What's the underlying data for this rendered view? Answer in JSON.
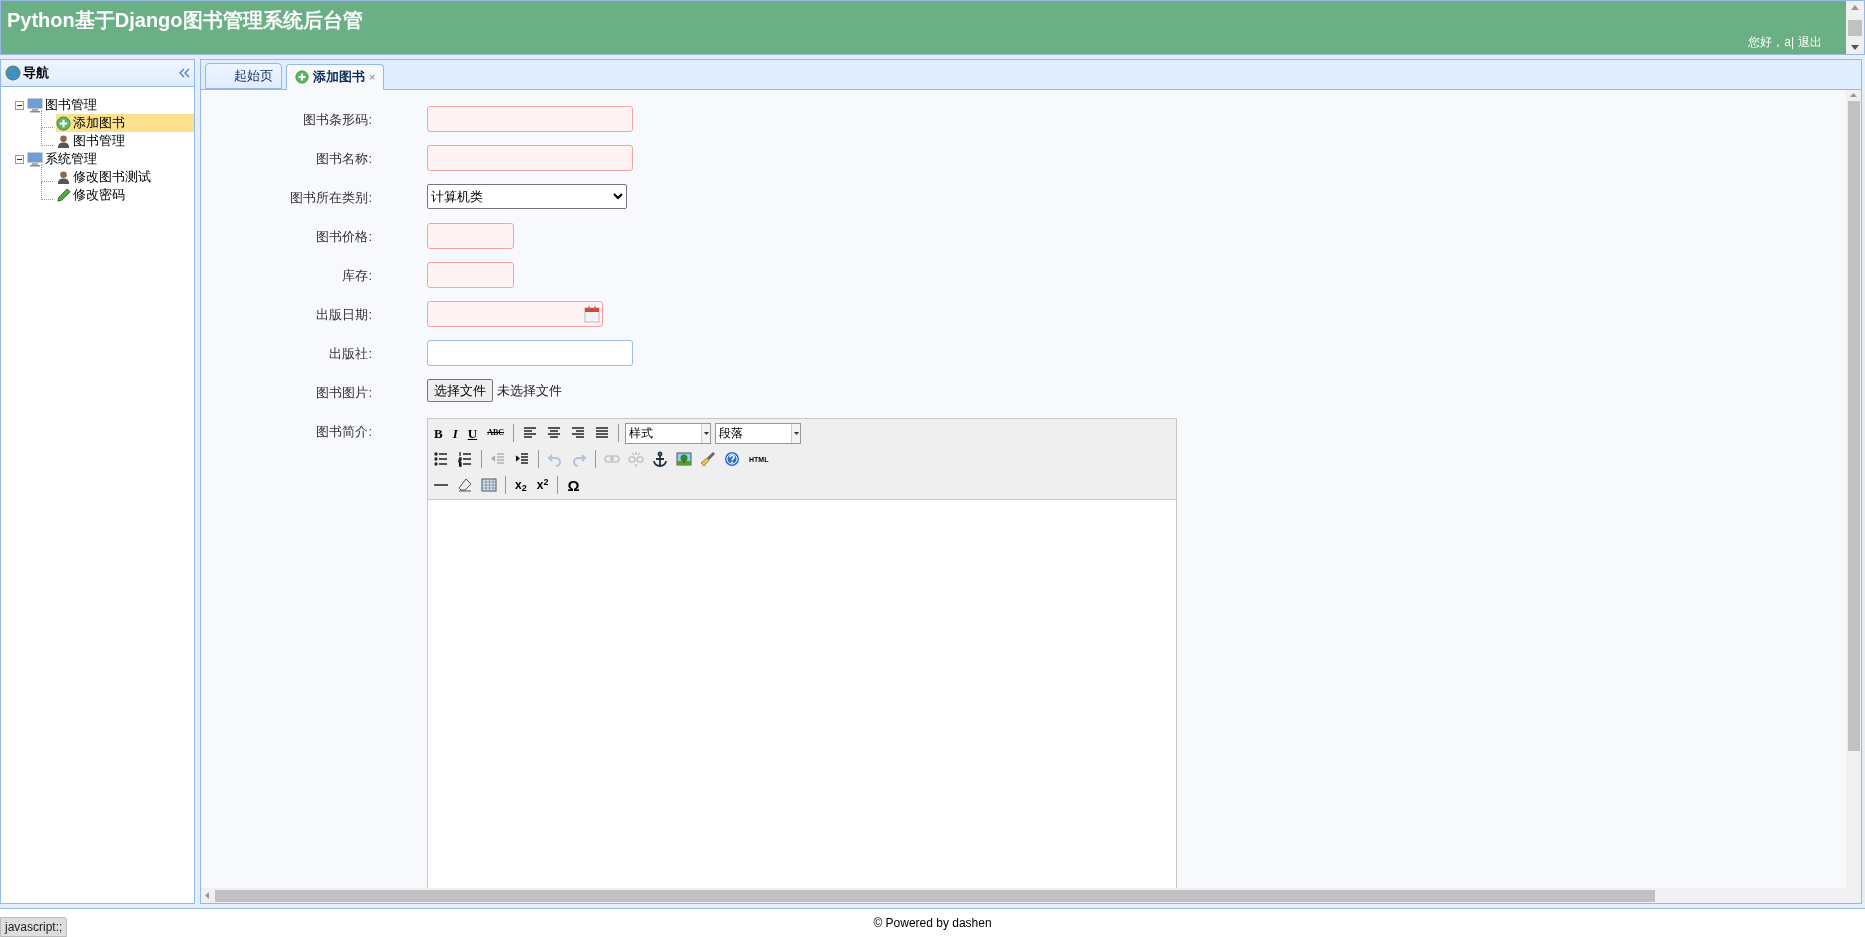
{
  "header": {
    "title": "Python基于Django图书管理系统后台管",
    "greeting": "您好，a|",
    "logout": "退出"
  },
  "sidebar": {
    "title": "导航",
    "tree": [
      {
        "label": "图书管理",
        "kind": "group",
        "expanded": true,
        "selected": false,
        "children": [
          {
            "label": "添加图书",
            "kind": "add",
            "selected": true
          },
          {
            "label": "图书管理",
            "kind": "user",
            "selected": false
          }
        ]
      },
      {
        "label": "系统管理",
        "kind": "group",
        "expanded": true,
        "selected": false,
        "children": [
          {
            "label": "修改图书测试",
            "kind": "user",
            "selected": false
          },
          {
            "label": "修改密码",
            "kind": "edit",
            "selected": false
          }
        ]
      }
    ]
  },
  "tabs": [
    {
      "label": "起始页",
      "selected": false
    },
    {
      "label": "添加图书",
      "selected": true,
      "close": "×"
    }
  ],
  "form": {
    "fields": [
      {
        "label": "图书条形码:",
        "kind": "text",
        "required": true
      },
      {
        "label": "图书名称:",
        "kind": "text",
        "required": true
      },
      {
        "label": "图书所在类别:",
        "kind": "select",
        "value": "计算机类"
      },
      {
        "label": "图书价格:",
        "kind": "short",
        "required": true
      },
      {
        "label": "库存:",
        "kind": "short",
        "required": true
      },
      {
        "label": "出版日期:",
        "kind": "date",
        "required": true
      },
      {
        "label": "出版社:",
        "kind": "text",
        "required": false
      },
      {
        "label": "图书图片:",
        "kind": "file",
        "button": "选择文件",
        "status": "未选择文件"
      },
      {
        "label": "图书简介:",
        "kind": "editor"
      }
    ]
  },
  "editor": {
    "toolbar": [
      [
        {
          "kind": "glyph",
          "text": "B"
        },
        {
          "kind": "glyph",
          "text": "I"
        },
        {
          "kind": "glyph",
          "text": "U"
        },
        {
          "kind": "glyph",
          "text": "ABC"
        },
        {
          "kind": "separator"
        },
        {
          "kind": "icon",
          "disabled": false
        },
        {
          "kind": "icon",
          "disabled": false
        },
        {
          "kind": "icon",
          "disabled": false
        },
        {
          "kind": "icon",
          "disabled": false
        },
        {
          "kind": "separator"
        },
        {
          "kind": "dropdown",
          "text": "样式"
        },
        {
          "kind": "dropdown",
          "text": "段落"
        }
      ],
      [
        {
          "kind": "icon",
          "disabled": false
        },
        {
          "kind": "icon",
          "disabled": false
        },
        {
          "kind": "separator"
        },
        {
          "kind": "icon",
          "disabled": true
        },
        {
          "kind": "icon",
          "disabled": false
        },
        {
          "kind": "separator"
        },
        {
          "kind": "icon",
          "disabled": true
        },
        {
          "kind": "icon",
          "disabled": true
        },
        {
          "kind": "separator"
        },
        {
          "kind": "icon",
          "disabled": true
        },
        {
          "kind": "icon",
          "disabled": true
        },
        {
          "kind": "icon",
          "disabled": false
        },
        {
          "kind": "icon",
          "disabled": false
        },
        {
          "kind": "icon",
          "disabled": false
        },
        {
          "kind": "icon",
          "disabled": false
        },
        {
          "kind": "glyph",
          "text": "HTML"
        }
      ],
      [
        {
          "kind": "icon",
          "disabled": false
        },
        {
          "kind": "icon",
          "disabled": false
        },
        {
          "kind": "icon",
          "disabled": false
        },
        {
          "kind": "separator"
        },
        {
          "kind": "glyph",
          "text": "x$_{2}$"
        },
        {
          "kind": "glyph",
          "text": "x$^{2}$"
        },
        {
          "kind": "separator"
        },
        {
          "kind": "glyph",
          "text": "Ω"
        }
      ]
    ]
  },
  "footer": {
    "text": "© Powered by dashen"
  },
  "status_tooltip": "javascript:;"
}
